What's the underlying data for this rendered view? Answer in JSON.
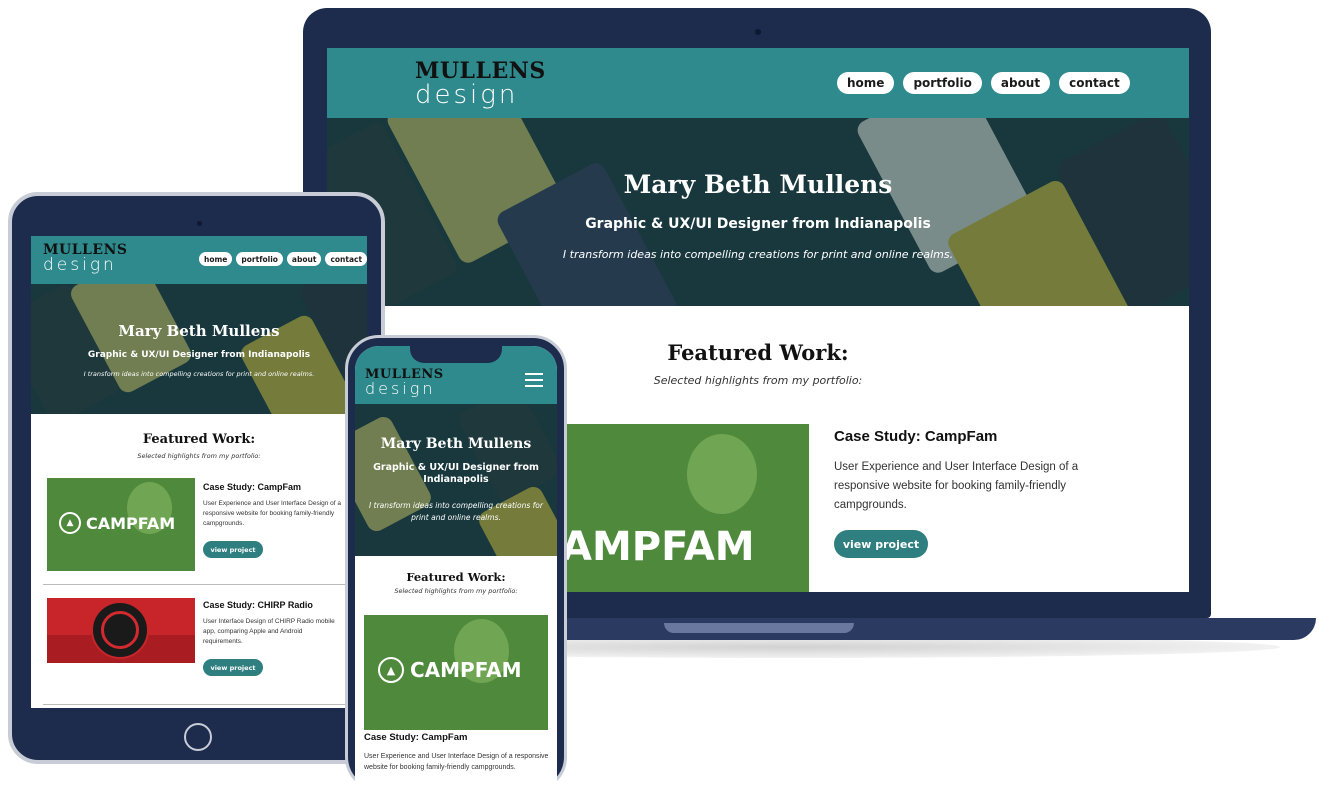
{
  "brand": {
    "logo_top": "MULLENS",
    "logo_bottom": "design"
  },
  "nav": {
    "items": [
      "home",
      "portfolio",
      "about",
      "contact"
    ]
  },
  "hero": {
    "name": "Mary Beth Mullens",
    "subtitle": "Graphic & UX/UI Designer from Indianapolis",
    "tagline": "I transform ideas into compelling creations for print and online realms."
  },
  "featured": {
    "title": "Featured Work:",
    "subtitle": "Selected highlights from my portfolio:"
  },
  "projects": [
    {
      "title": "Case Study: CampFam",
      "description": "User Experience and User Interface Design of a responsive website for booking family-friendly campgrounds.",
      "button": "view project",
      "logo_text": "CAMPFAM"
    },
    {
      "title": "Case Study: CHIRP Radio",
      "description": "User Interface Design of CHIRP Radio mobile app, comparing Apple and Android requirements.",
      "button": "view project"
    }
  ],
  "laptop_logo_partial": "AMPFAM",
  "phone_project_description": "User Experience and User Interface Design of a responsive website for booking family-friendly campgrounds.",
  "icons": {
    "menu": "hamburger-menu-icon",
    "tent": "tent-icon"
  },
  "colors": {
    "header": "#2f8a8d",
    "frame": "#1d2b4d",
    "button": "#2f7e80",
    "campfam_green": "#4f8a3c",
    "chirp_red": "#c8252a"
  }
}
